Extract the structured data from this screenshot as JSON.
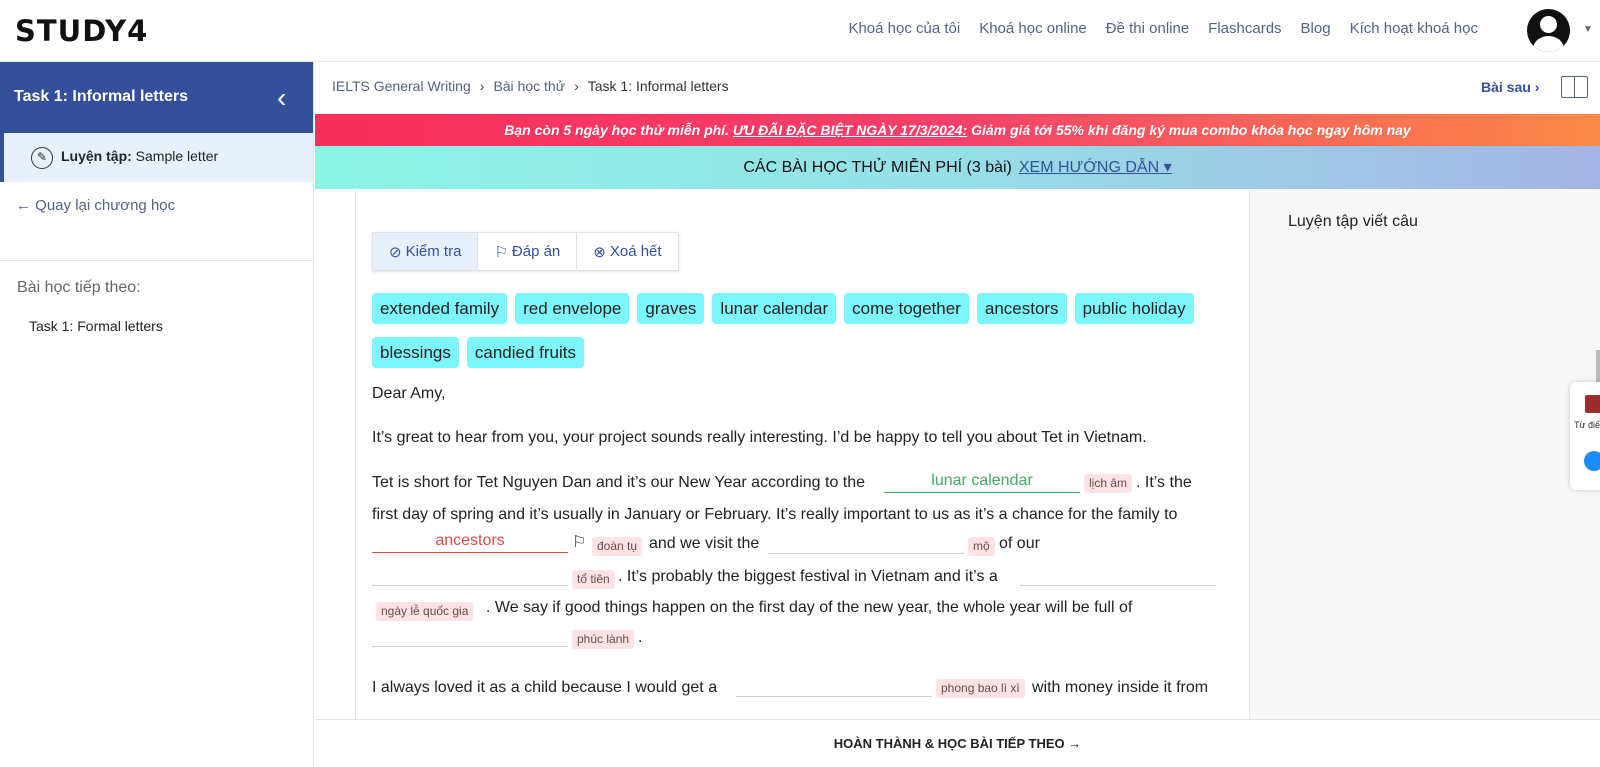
{
  "header": {
    "logo": "STUDY4",
    "nav": [
      "Khoá học của tôi",
      "Khoá học online",
      "Đề thi online",
      "Flashcards",
      "Blog",
      "Kích hoạt khoá học"
    ]
  },
  "sidebar": {
    "title": "Task 1: Informal letters",
    "practice_label": "Luyện tập:",
    "practice_value": "Sample letter",
    "back_label": "Quay lại chương học",
    "next_title": "Bài học tiếp theo:",
    "next_item": "Task 1: Formal letters"
  },
  "breadcrumb": {
    "items": [
      "IELTS General Writing",
      "Bài học thử",
      "Task 1: Informal letters"
    ]
  },
  "top_actions": {
    "next_label": "Bài sau"
  },
  "promo": {
    "text1": "Bạn còn 5 ngày học thử miễn phí.",
    "highlight": "ƯU ĐÃI ĐẶC BIỆT NGÀY 17/3/2024:",
    "text2": "Giảm giá tới 55% khi đăng ký mua combo khóa học ngay hôm nay"
  },
  "free_banner": {
    "text": "CÁC BÀI HỌC THỬ MIỄN PHÍ (3 bài)",
    "guide": "XEM HƯỚNG DẪN"
  },
  "tools": {
    "check": "Kiểm tra",
    "answer": "Đáp án",
    "clear": "Xoá hết"
  },
  "chips": [
    "extended family",
    "red envelope",
    "graves",
    "lunar calendar",
    "come together",
    "ancestors",
    "public holiday",
    "blessings",
    "candied fruits"
  ],
  "letter": {
    "greeting": "Dear Amy,",
    "p1": "It’s great to hear from you, your project sounds really interesting. I’d be happy to tell you about Tet in Vietnam.",
    "p2a": "Tet is short for Tet Nguyen Dan and it’s our New Year according to the",
    "blank1": "lunar calendar",
    "hint1": "lịch âm",
    "p2b": ". It’s the",
    "p2c": "first day of spring and it’s usually in January or February. It’s really important to us as it’s a chance for the family to",
    "blank2": "ancestors",
    "hint2": "đoàn tụ",
    "p2d": "and we visit the",
    "hint3": "mộ",
    "p2e": "of our",
    "hint4": "tổ tiên",
    "p2f": ". It’s probably the biggest festival in Vietnam and it’s a",
    "hint5": "ngày lễ quốc gia",
    "p2g": ". We say if good things happen on the first day of the new year, the whole year will be full of",
    "hint6": "phúc lành",
    "p2h": ".",
    "p3a": "I always loved it as a child because I would get a",
    "hint7": "phong bao lì xì",
    "p3b": "with money inside it from"
  },
  "right_panel": {
    "title": "Luyện tập viết câu"
  },
  "footer": {
    "complete": "HOÀN THÀNH & HỌC BÀI TIẾP THEO"
  },
  "widget": {
    "dict_label": "Từ điển"
  },
  "colors": {
    "primary": "#35509a",
    "chip": "#7df6fb",
    "correct": "#45a866",
    "wrong": "#e14b4b"
  }
}
